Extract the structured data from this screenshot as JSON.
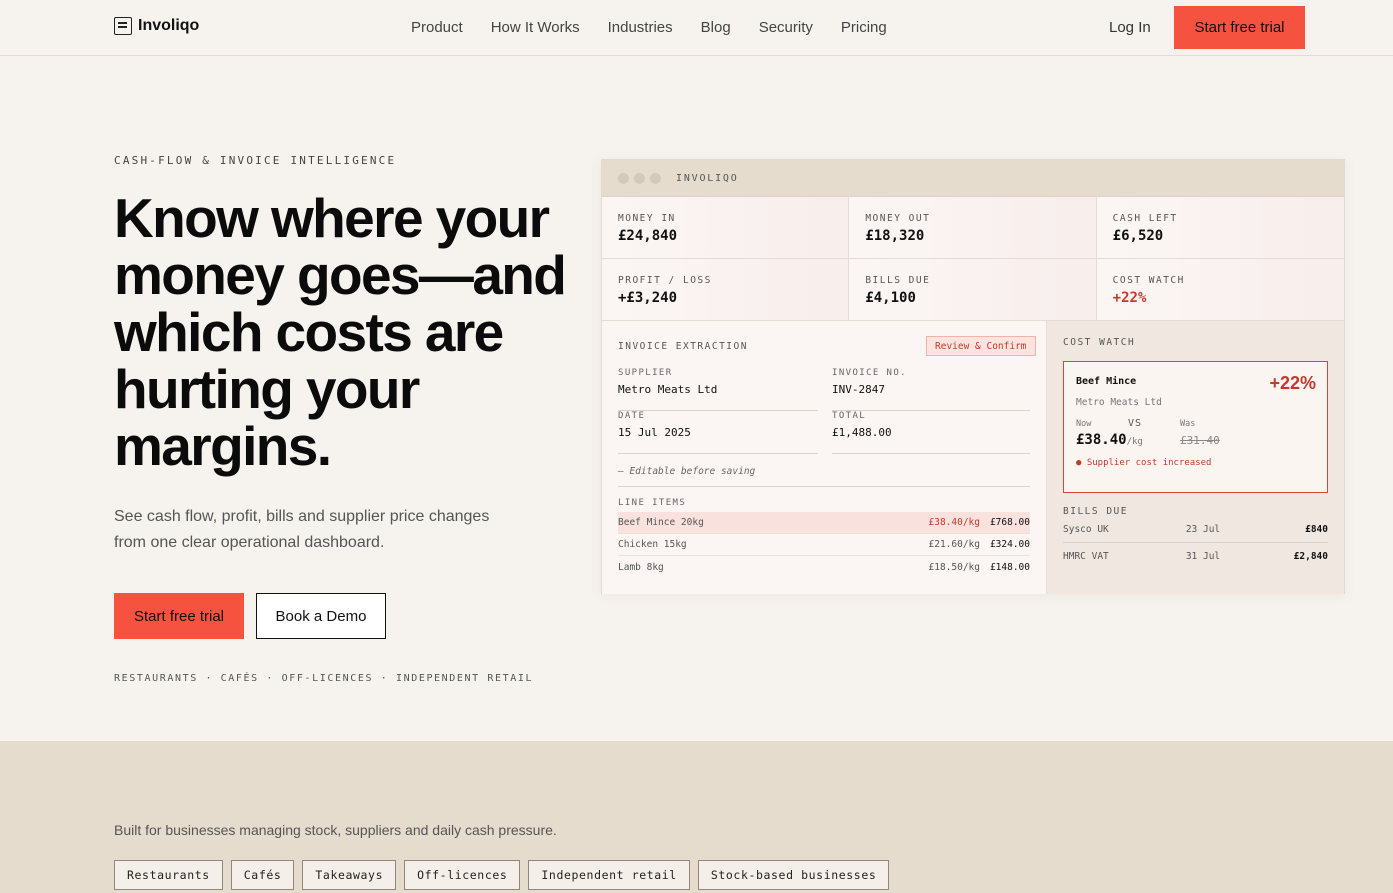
{
  "nav": {
    "brand": "Involiqo",
    "links": [
      "Product",
      "How It Works",
      "Industries",
      "Blog",
      "Security",
      "Pricing"
    ],
    "login": "Log In",
    "cta": "Start free trial"
  },
  "hero": {
    "eyebrow": "CASH-FLOW & INVOICE INTELLIGENCE",
    "headline": "Know where your money goes—and which costs are hurting your margins.",
    "subtext": "See cash flow, profit, bills and supplier price changes from one clear operational dashboard.",
    "primary_cta": "Start free trial",
    "secondary_cta": "Book a Demo",
    "segments": "RESTAURANTS · CAFÉS · OFF-LICENCES · INDEPENDENT RETAIL"
  },
  "dashboard": {
    "window_title": "INVOLIQO",
    "metrics": [
      {
        "label": "MONEY IN",
        "value": "£24,840"
      },
      {
        "label": "MONEY OUT",
        "value": "£18,320"
      },
      {
        "label": "CASH LEFT",
        "value": "£6,520"
      },
      {
        "label": "PROFIT / LOSS",
        "value": "+£3,240"
      },
      {
        "label": "BILLS DUE",
        "value": "£4,100"
      },
      {
        "label": "COST WATCH",
        "value": "+22%"
      }
    ],
    "extraction": {
      "title": "INVOICE EXTRACTION",
      "review_button": "Review & Confirm",
      "fields": [
        {
          "label": "SUPPLIER",
          "value": "Metro Meats Ltd"
        },
        {
          "label": "INVOICE NO.",
          "value": "INV-2847"
        },
        {
          "label": "DATE",
          "value": "15 Jul 2025"
        },
        {
          "label": "TOTAL",
          "value": "£1,488.00"
        }
      ],
      "editable_note": "— Editable before saving",
      "line_items_title": "LINE ITEMS",
      "line_items": [
        {
          "name": "Beef Mince 20kg",
          "rate": "£38.40/kg",
          "total": "£768.00"
        },
        {
          "name": "Chicken 15kg",
          "rate": "£21.60/kg",
          "total": "£324.00"
        },
        {
          "name": "Lamb 8kg",
          "rate": "£18.50/kg",
          "total": "£148.00"
        }
      ]
    },
    "cost_watch": {
      "title": "COST WATCH",
      "item": "Beef Mince",
      "supplier": "Metro Meats Ltd",
      "change": "+22%",
      "now_label": "Now",
      "vs_label": "VS",
      "was_label": "Was",
      "now_price": "£38.40",
      "unit": "/kg",
      "was_price": "£31.40",
      "note": "● Supplier cost increased"
    },
    "bills_due": {
      "title": "BILLS DUE",
      "rows": [
        {
          "name": "Sysco UK",
          "date": "23 Jul",
          "amount": "£840"
        },
        {
          "name": "HMRC VAT",
          "date": "31 Jul",
          "amount": "£2,840"
        }
      ]
    }
  },
  "band": {
    "text": "Built for businesses managing stock, suppliers and daily cash pressure.",
    "chips": [
      "Restaurants",
      "Cafés",
      "Takeaways",
      "Off-licences",
      "Independent retail",
      "Stock-based businesses"
    ]
  },
  "colors": {
    "accent": "#f5523f",
    "alert_red": "#c23a2c",
    "background": "#f6f3ef",
    "band": "#e6dccd"
  }
}
